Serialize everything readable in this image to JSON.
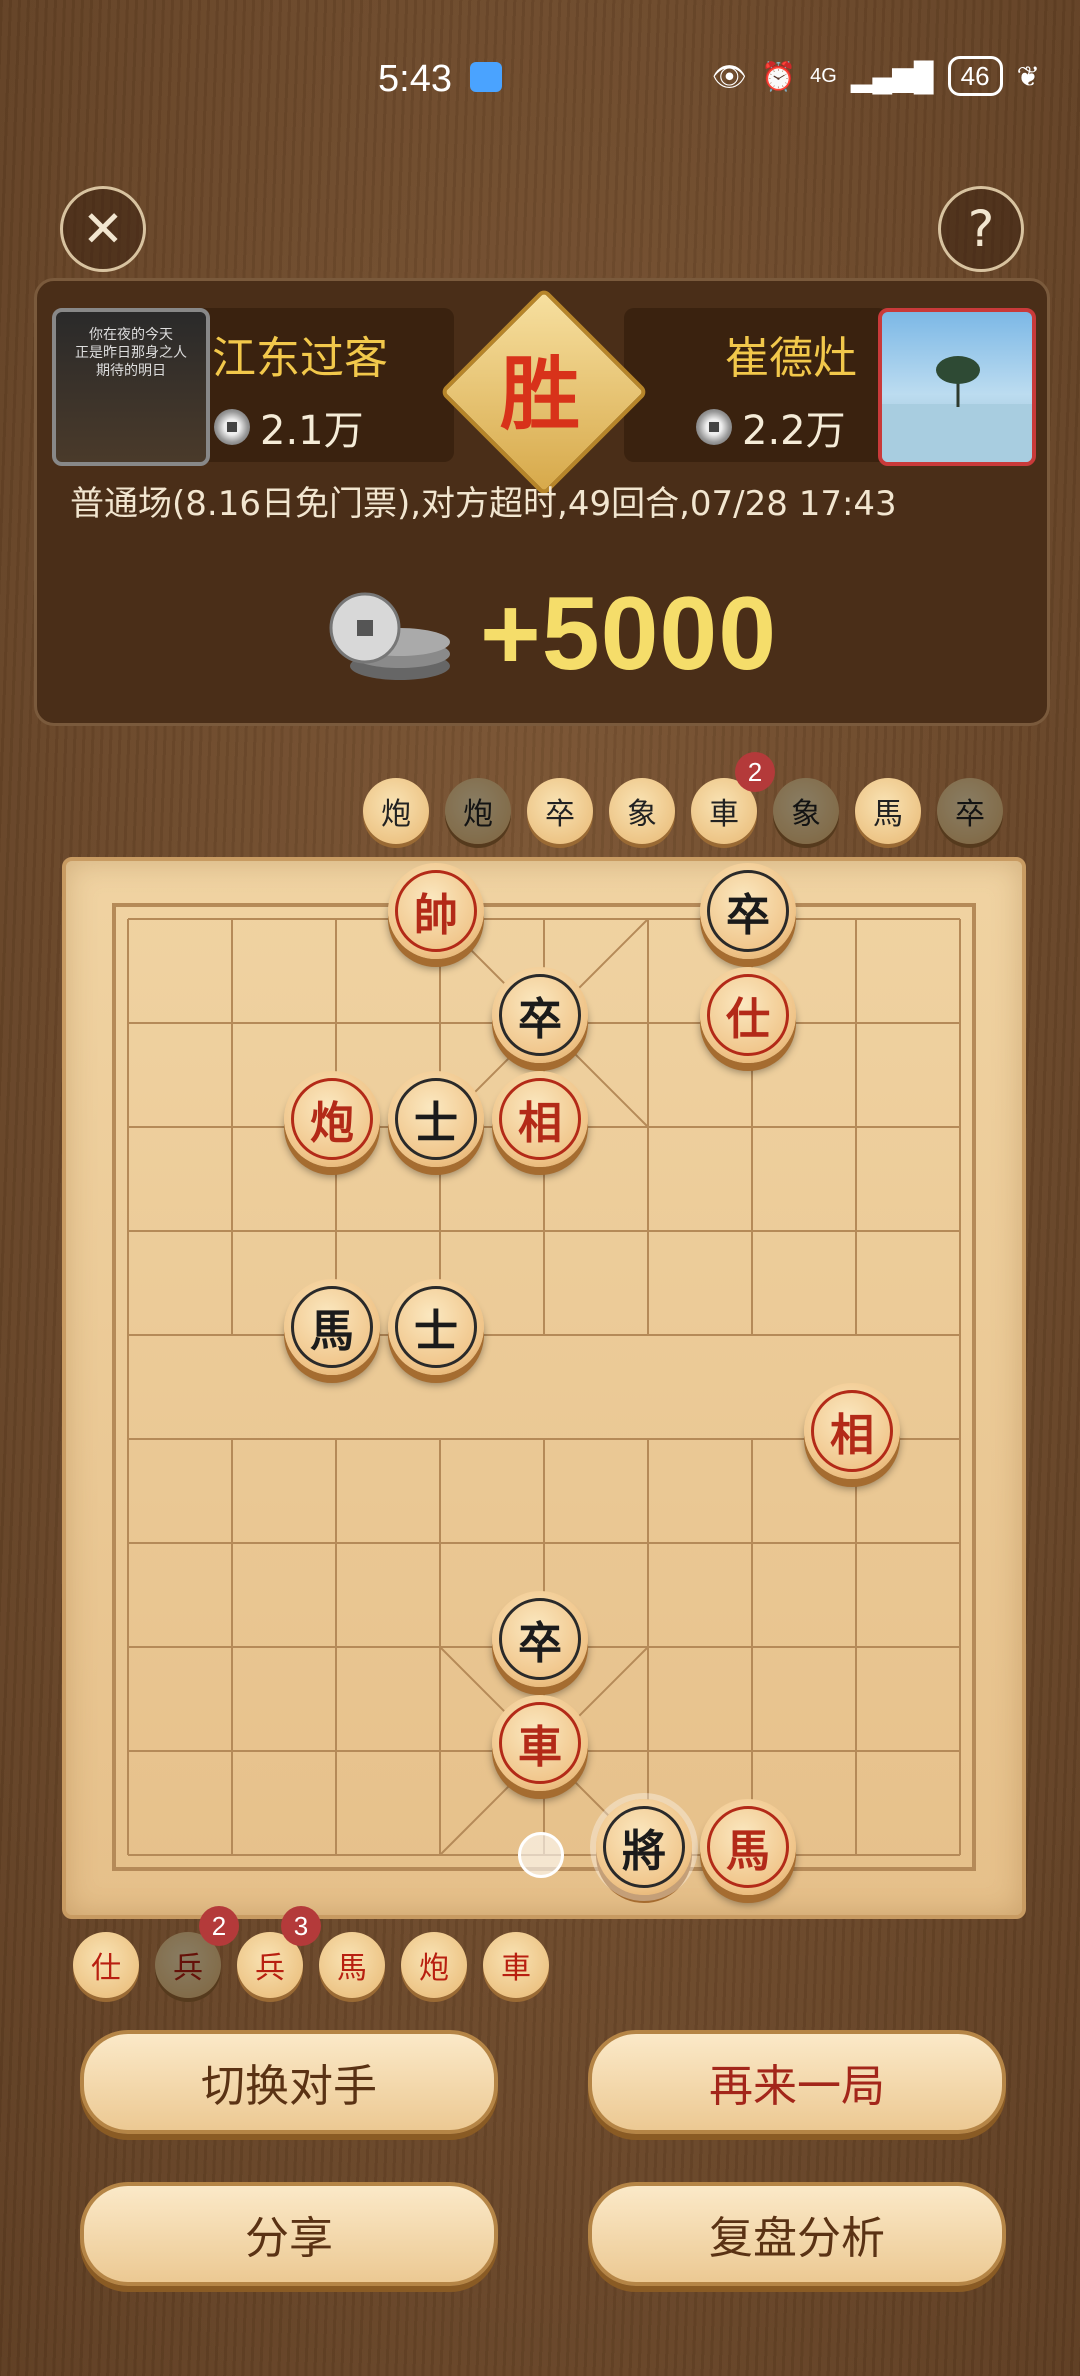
{
  "status_bar": {
    "time": "5:43",
    "network": "4G",
    "battery": "46"
  },
  "header": {
    "close_icon": "close-icon",
    "help_label": "?"
  },
  "players": {
    "left": {
      "name": "江东过客",
      "coins": "2.1万",
      "avatar_text": [
        "你在夜的今天",
        "正是昨日那身之人",
        "期待的明日"
      ]
    },
    "right": {
      "name": "崔德灶",
      "coins": "2.2万"
    }
  },
  "result": {
    "badge": "胜",
    "info": "普通场(8.16日免门票),对方超时,49回合,07/28 17:43",
    "reward": "+5000"
  },
  "captured_top": [
    {
      "label": "炮",
      "side": "black",
      "dim": false
    },
    {
      "label": "炮",
      "side": "black",
      "dim": true
    },
    {
      "label": "卒",
      "side": "black",
      "dim": false
    },
    {
      "label": "象",
      "side": "black",
      "dim": false
    },
    {
      "label": "車",
      "side": "black",
      "dim": false,
      "count": "2"
    },
    {
      "label": "象",
      "side": "black",
      "dim": true
    },
    {
      "label": "馬",
      "side": "black",
      "dim": false
    },
    {
      "label": "卒",
      "side": "black",
      "dim": true
    }
  ],
  "captured_bottom": [
    {
      "label": "仕",
      "side": "red",
      "dim": false
    },
    {
      "label": "兵",
      "side": "red",
      "dim": true,
      "count": "2"
    },
    {
      "label": "兵",
      "side": "red",
      "dim": false,
      "count": "3"
    },
    {
      "label": "馬",
      "side": "red",
      "dim": false
    },
    {
      "label": "炮",
      "side": "red",
      "dim": false
    },
    {
      "label": "車",
      "side": "red",
      "dim": false
    }
  ],
  "board_pieces": [
    {
      "label": "帥",
      "side": "red",
      "col": 3,
      "row": 0
    },
    {
      "label": "卒",
      "side": "black",
      "col": 6,
      "row": 0
    },
    {
      "label": "卒",
      "side": "black",
      "col": 4,
      "row": 1
    },
    {
      "label": "仕",
      "side": "red",
      "col": 6,
      "row": 1
    },
    {
      "label": "炮",
      "side": "red",
      "col": 2,
      "row": 2
    },
    {
      "label": "士",
      "side": "black",
      "col": 3,
      "row": 2
    },
    {
      "label": "相",
      "side": "red",
      "col": 4,
      "row": 2
    },
    {
      "label": "馬",
      "side": "black",
      "col": 2,
      "row": 4
    },
    {
      "label": "士",
      "side": "black",
      "col": 3,
      "row": 4
    },
    {
      "label": "相",
      "side": "red",
      "col": 7,
      "row": 5
    },
    {
      "label": "卒",
      "side": "black",
      "col": 4,
      "row": 7
    },
    {
      "label": "車",
      "side": "red",
      "col": 4,
      "row": 8
    },
    {
      "label": "將",
      "side": "black",
      "col": 5,
      "row": 9
    },
    {
      "label": "馬",
      "side": "red",
      "col": 6,
      "row": 9
    }
  ],
  "buttons": {
    "switch": "切换对手",
    "again": "再来一局",
    "share": "分享",
    "review": "复盘分析"
  }
}
